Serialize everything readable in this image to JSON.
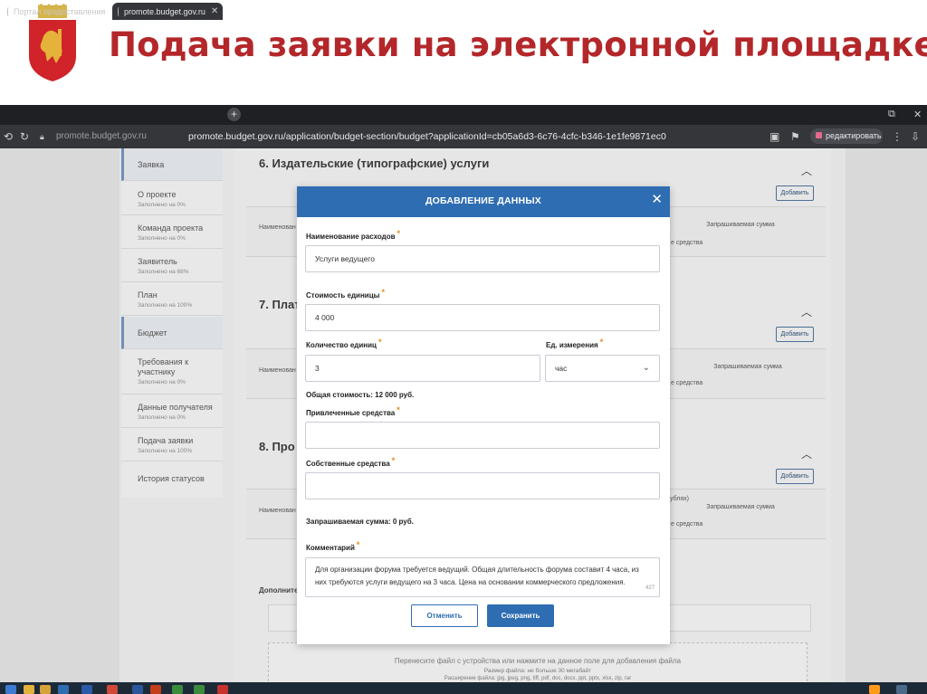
{
  "slide": {
    "title": "Подача заявки на электронной площадке"
  },
  "browser": {
    "tabs": [
      {
        "label": "Портал предоставления"
      },
      {
        "label": "promote.budget.gov.ru"
      }
    ],
    "address_left": "promote.budget.gov.ru",
    "url": "promote.budget.gov.ru/application/budget-section/budget?applicationId=cb05a6d3-6c76-4cfc-b346-1e1fe9871ec0",
    "edit_label": "редактировать"
  },
  "sidebar": {
    "items": [
      {
        "label": "Заявка",
        "sub": ""
      },
      {
        "label": "О проекте",
        "sub": "Заполнено на 0%"
      },
      {
        "label": "Команда проекта",
        "sub": "Заполнено на 0%"
      },
      {
        "label": "Заявитель",
        "sub": "Заполнено на 68%"
      },
      {
        "label": "План",
        "sub": "Заполнено на 100%"
      },
      {
        "label": "Бюджет",
        "sub": ""
      },
      {
        "label": "Требования к участнику",
        "sub": "Заполнено на 0%"
      },
      {
        "label": "Данные получателя",
        "sub": "Заполнено на 0%"
      },
      {
        "label": "Подача заявки",
        "sub": "Заполнено на 100%"
      },
      {
        "label": "История статусов",
        "sub": ""
      }
    ]
  },
  "sections": {
    "s6": "6. Издательские (типографские) услуги",
    "s7": "7. Плат",
    "s8": "8. Про",
    "add_label": "Добавить",
    "col_name": "Наименован",
    "col_means": "е средства",
    "col_requested": "Запрашиваемая сумма",
    "col_rub": "ублях)",
    "additional": "Дополните"
  },
  "modal": {
    "title": "ДОБАВЛЕНИЕ ДАННЫХ",
    "expense_name_label": "Наименование расходов",
    "expense_name_value": "Услуги ведущего",
    "unit_cost_label": "Стоимость единицы",
    "unit_cost_value": "4 000",
    "quantity_label": "Количество единиц",
    "quantity_value": "3",
    "unit_label": "Ед. измерения",
    "unit_value": "час",
    "total_cost": "Общая стоимость: 12 000 руб.",
    "attracted_label": "Привлеченные средства",
    "own_label": "Собственные средства",
    "requested_sum": "Запрашиваемая сумма: 0 руб.",
    "comment_label": "Комментарий",
    "comment_value": "Для организации форума требуется ведущий. Общая длительность форума составит 4 часа, из них требуются услуги ведущего на 3 часа. Цена на основании коммерческого предложения.",
    "counter": "427",
    "cancel_label": "Отменить",
    "save_label": "Сохранить"
  },
  "upload": {
    "hint": "Перенесите файл с устройства или нажмите на данное поле для добавления файла",
    "size": "Размер файла: не больше 30 мегабайт",
    "formats": "Расширение файла: jpg, jpeg, png, tiff, pdf, doc, docx, ppt, pptx, xlsx, zip, rar"
  },
  "colors": {
    "title_red": "#b3272a",
    "modal_blue": "#2f6db2",
    "required_orange": "#e58a1a"
  }
}
